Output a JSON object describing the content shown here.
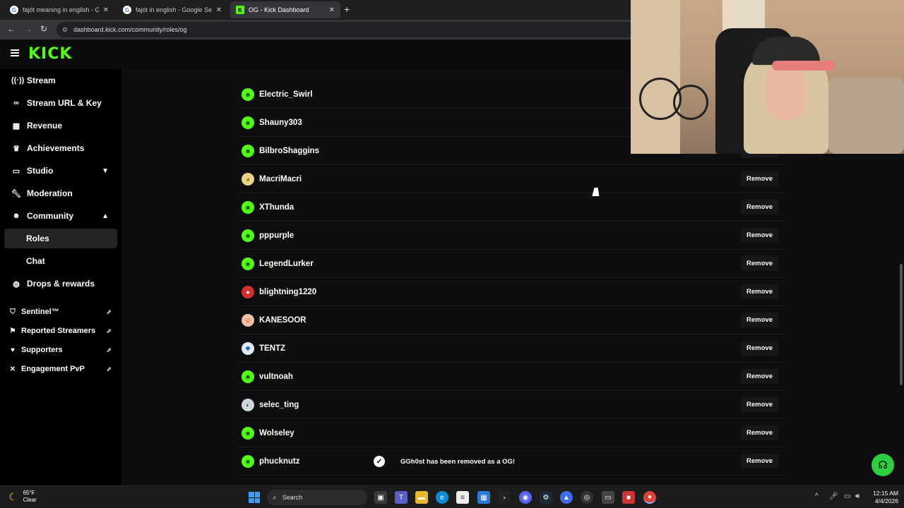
{
  "browser": {
    "tabs": [
      {
        "title": "fajót meaning in english - Goo",
        "favicon": "G",
        "active": false
      },
      {
        "title": "fajót in english - Google Search",
        "favicon": "G",
        "active": false
      },
      {
        "title": "OG - Kick Dashboard",
        "favicon": "K",
        "active": true
      }
    ],
    "new_tab": "+",
    "url": "dashboard.kick.com/community/roles/og"
  },
  "header": {
    "logo": "KICK"
  },
  "sidebar": {
    "items": [
      {
        "label": "Stream",
        "icon": "broadcast-icon"
      },
      {
        "label": "Stream URL & Key",
        "icon": "link-icon"
      },
      {
        "label": "Revenue",
        "icon": "chart-icon"
      },
      {
        "label": "Achievements",
        "icon": "trophy-icon"
      },
      {
        "label": "Studio",
        "icon": "monitor-icon",
        "chevron": "down"
      },
      {
        "label": "Moderation",
        "icon": "wrench-icon"
      },
      {
        "label": "Community",
        "icon": "people-icon",
        "chevron": "up"
      },
      {
        "label": "Roles",
        "sub": true,
        "active": true
      },
      {
        "label": "Chat",
        "sub": true
      },
      {
        "label": "Drops & rewards",
        "icon": "gift-icon"
      }
    ],
    "extensions": [
      {
        "label": "Sentinel™",
        "icon": "shield-icon"
      },
      {
        "label": "Reported Streamers",
        "icon": "flag-icon"
      },
      {
        "label": "Supporters",
        "icon": "heart-icon"
      },
      {
        "label": "Engagement PvP",
        "icon": "swords-icon"
      }
    ]
  },
  "og_list": {
    "remove_label": "Remove",
    "rows": [
      {
        "name": "Electric_Swirl",
        "avatar": "green"
      },
      {
        "name": "Shauny303",
        "avatar": "green"
      },
      {
        "name": "BilbroShaggins",
        "avatar": "green"
      },
      {
        "name": "MacriMacri",
        "avatar": "yellow"
      },
      {
        "name": "XThunda",
        "avatar": "green"
      },
      {
        "name": "pppurple",
        "avatar": "green"
      },
      {
        "name": "LegendLurker",
        "avatar": "green"
      },
      {
        "name": "blightning1220",
        "avatar": "red"
      },
      {
        "name": "KANESOOR",
        "avatar": "pink"
      },
      {
        "name": "TENTZ",
        "avatar": "blue"
      },
      {
        "name": "vultnoah",
        "avatar": "green"
      },
      {
        "name": "selec_ting",
        "avatar": "gray"
      },
      {
        "name": "Wolseley",
        "avatar": "green"
      },
      {
        "name": "phucknutz",
        "avatar": "green"
      }
    ]
  },
  "toast": {
    "message": "GGh0st has been removed as a OG!"
  },
  "taskbar": {
    "weather_temp": "65°F",
    "weather_cond": "Clear",
    "search_label": "Search",
    "time": "12:15 AM",
    "date": "4/4/2026"
  },
  "colors": {
    "accent": "#53fc18",
    "background": "#0e0e10"
  }
}
